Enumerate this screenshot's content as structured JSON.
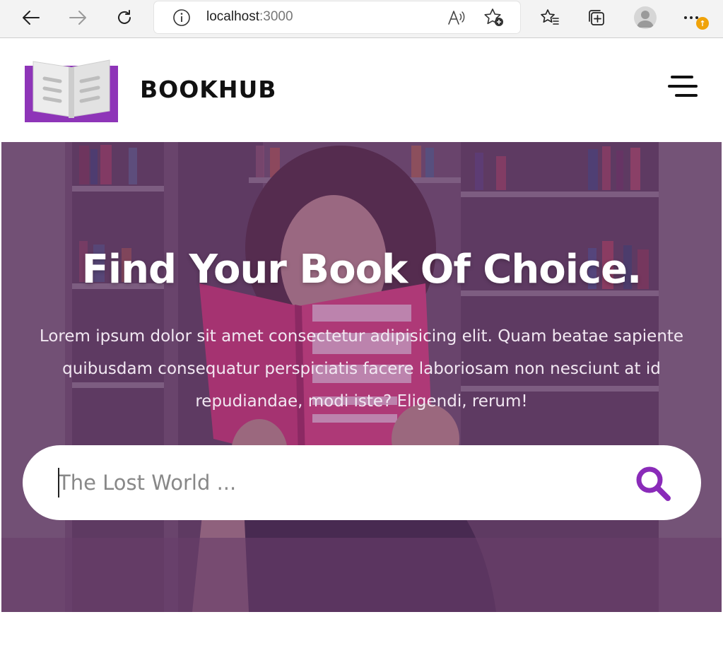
{
  "browser": {
    "url_host": "localhost",
    "url_port": ":3000",
    "notification_badge": "↑"
  },
  "navbar": {
    "brand": "BOOKHUB",
    "logo_icon": "open-book-icon",
    "menu_icon": "hamburger-menu-icon"
  },
  "hero": {
    "title": "Find Your Book Of Choice.",
    "description": "Lorem ipsum dolor sit amet consectetur adipisicing elit. Quam beatae sapiente quibusdam consequatur perspiciatis facere laboriosam non nesciunt at id repudiandae, modi iste? Eligendi, rerum!"
  },
  "search": {
    "placeholder": "The Lost World ...",
    "value": "",
    "icon": "search-icon"
  },
  "colors": {
    "accent": "#8a2bb9",
    "hero_overlay": "#64287a",
    "logo_purple": "#8e35b8"
  }
}
